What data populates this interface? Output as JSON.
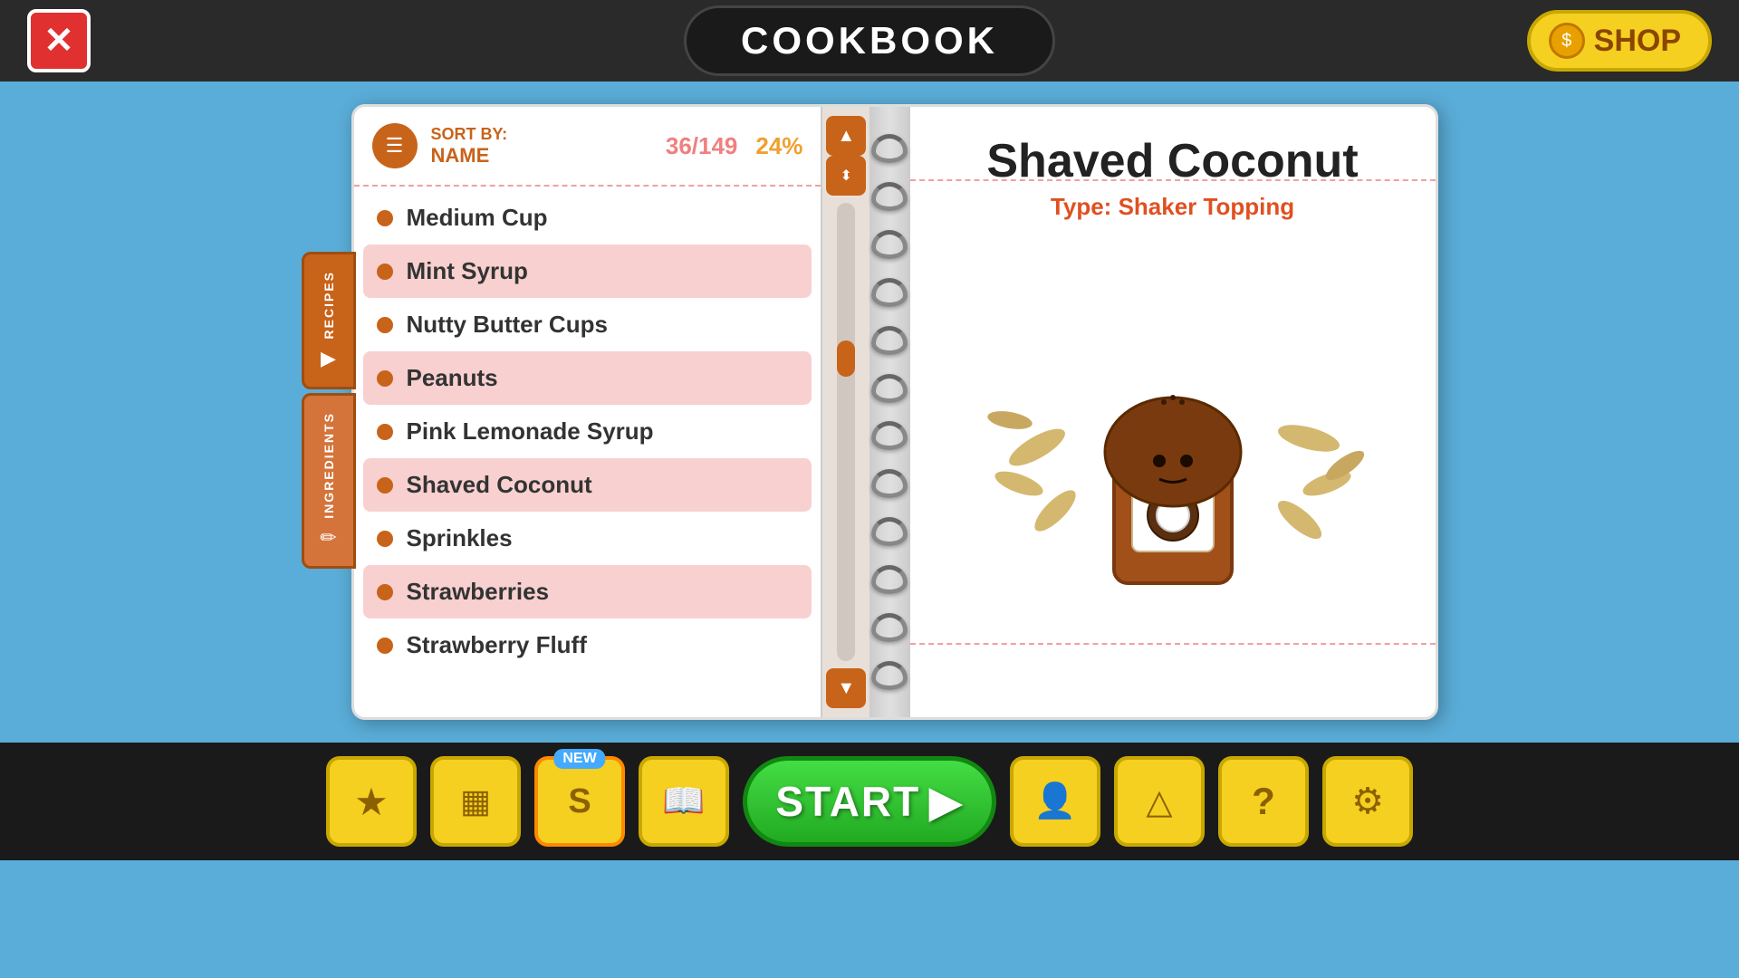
{
  "topBar": {
    "title": "COOKBOOK",
    "closeLabel": "✕",
    "shopLabel": "SHOP"
  },
  "sortHeader": {
    "sortByLabel": "SORT BY:",
    "sortNameLabel": "NAME",
    "countLabel": "36/149",
    "percentLabel": "24%"
  },
  "ingredientList": [
    {
      "name": "Medium Cup",
      "highlighted": false
    },
    {
      "name": "Mint Syrup",
      "highlighted": true
    },
    {
      "name": "Nutty Butter Cups",
      "highlighted": false
    },
    {
      "name": "Peanuts",
      "highlighted": true
    },
    {
      "name": "Pink Lemonade Syrup",
      "highlighted": false
    },
    {
      "name": "Shaved Coconut",
      "highlighted": true
    },
    {
      "name": "Sprinkles",
      "highlighted": false
    },
    {
      "name": "Strawberries",
      "highlighted": true
    },
    {
      "name": "Strawberry Fluff",
      "highlighted": false
    }
  ],
  "detailPanel": {
    "ingredientName": "Shaved Coconut",
    "typeLabel": "Type:",
    "typeValue": "Shaker Topping"
  },
  "sideTabs": [
    {
      "label": "RECIPES",
      "icon": "▶"
    },
    {
      "label": "INGREDIENTS",
      "icon": "✏"
    }
  ],
  "bottomNav": {
    "startLabel": "START",
    "buttons": [
      {
        "icon": "★",
        "label": "favorites"
      },
      {
        "icon": "▦",
        "label": "locker"
      },
      {
        "icon": "S",
        "label": "special",
        "badge": "NEW"
      },
      {
        "icon": "📖",
        "label": "cookbook"
      },
      {
        "icon": "▶",
        "label": "start"
      },
      {
        "icon": "👤",
        "label": "character"
      },
      {
        "icon": "△",
        "label": "awards"
      },
      {
        "icon": "?",
        "label": "help"
      },
      {
        "icon": "⚙",
        "label": "settings"
      }
    ]
  }
}
